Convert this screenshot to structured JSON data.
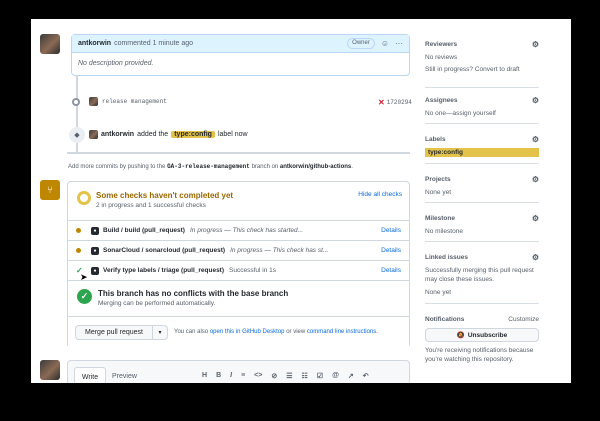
{
  "comment": {
    "author": "antkorwin",
    "meta": "commented 1 minute ago",
    "badge": "Owner",
    "emoji_icon": "smiley-icon",
    "more_icon": "kebab-icon",
    "body": "No description provided."
  },
  "timeline": {
    "commit_message": "release management",
    "commit_hash": "1720294",
    "label_actor": "antkorwin",
    "label_pre": "added the",
    "label_name": "type:config",
    "label_post": "label now"
  },
  "push_note": {
    "pre": "Add more commits by pushing to the",
    "branch": "GA-3-release-management",
    "mid": "branch on",
    "repo": "antkorwin/github-actions",
    "end": "."
  },
  "checks": {
    "title": "Some checks haven't completed yet",
    "subtitle": "2 in progress and 1 successful checks",
    "hide_all": "Hide all checks",
    "items": [
      {
        "name": "Build / build (pull_request)",
        "status": "In progress — This check has started...",
        "details": "Details"
      },
      {
        "name": "SonarCloud / sonarcloud (pull_request)",
        "status": "In progress — This check has st...",
        "details": "Details"
      },
      {
        "name": "Verify type labels / triage (pull_request)",
        "status": "Successful in 1s",
        "details": "Details"
      }
    ],
    "conflict_title": "This branch has no conflicts with the base branch",
    "conflict_sub": "Merging can be performed automatically.",
    "merge_button": "Merge pull request",
    "merge_note_pre": "You can also",
    "merge_note_link1": "open this in GitHub Desktop",
    "merge_note_mid": "or view",
    "merge_note_link2": "command line instructions",
    "merge_note_end": "."
  },
  "editor": {
    "tab_write": "Write",
    "tab_preview": "Preview",
    "toolbar": [
      "H",
      "B",
      "I",
      "≡",
      "<>",
      "⊘",
      "☰",
      "☷",
      "☑",
      "@",
      "↗",
      "↶"
    ]
  },
  "sidebar": {
    "reviewers": {
      "title": "Reviewers",
      "line1": "No reviews",
      "line2": "Still in progress? Convert to draft"
    },
    "assignees": {
      "title": "Assignees",
      "line1": "No one—assign yourself"
    },
    "labels": {
      "title": "Labels",
      "label": "type:config"
    },
    "projects": {
      "title": "Projects",
      "line1": "None yet"
    },
    "milestone": {
      "title": "Milestone",
      "line1": "No milestone"
    },
    "linked": {
      "title": "Linked issues",
      "line1": "Successfully merging this pull request may close these issues.",
      "line2": "None yet"
    },
    "notifications": {
      "title": "Notifications",
      "customize": "Customize",
      "button": "Unsubscribe",
      "line1": "You're receiving notifications because you're watching this repository."
    }
  },
  "colors": {
    "accent": "#0969da",
    "success": "#2da44e",
    "pending": "#bf8700",
    "label": "#e4c34a"
  }
}
